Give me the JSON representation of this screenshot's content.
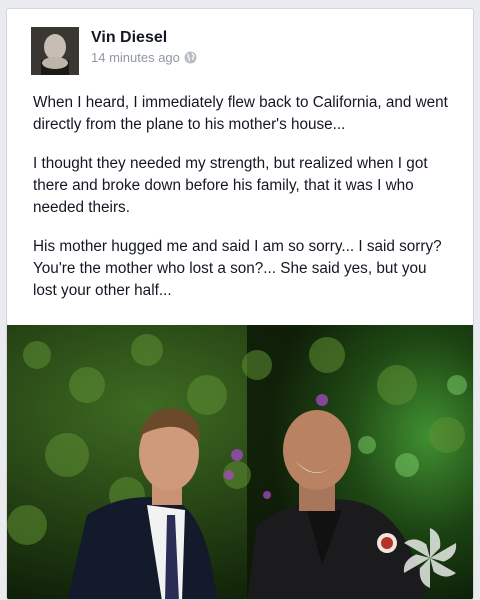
{
  "post": {
    "author": "Vin Diesel",
    "timestamp": "14 minutes ago",
    "privacy_icon": "globe-icon",
    "paragraphs": [
      "When I heard, I immediately flew back to California, and went directly from the plane to his mother's house...",
      "I thought they needed my strength, but realized when I got there and broke down before his family, that it was I who needed theirs.",
      "His mother hugged me and said I am so sorry... I said sorry? You're the mother who lost a son?... She said yes, but you lost your other half..."
    ]
  },
  "colors": {
    "name": "#141823",
    "meta": "#9197a3",
    "card_bg": "#ffffff",
    "page_bg": "#e9ebee"
  }
}
